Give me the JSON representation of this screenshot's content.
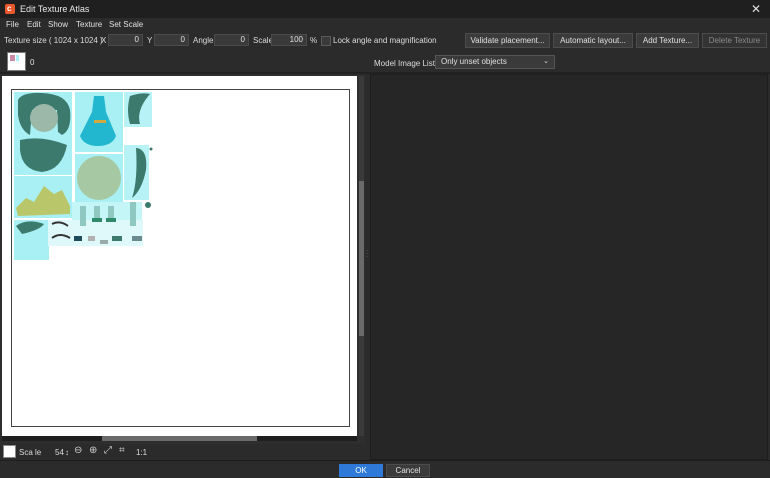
{
  "window": {
    "title": "Edit Texture Atlas",
    "app_icon": "clip-studio-icon",
    "close_icon": "close-icon"
  },
  "menu": [
    "File",
    "Edit",
    "Show",
    "Texture",
    "Set Scale"
  ],
  "toolbar": {
    "texture_size": "Texture size ( 1024 x 1024 )",
    "x_label": "X",
    "x_value": "0",
    "y_label": "Y",
    "y_value": "0",
    "angle_label": "Angle",
    "angle_value": "0",
    "scale_label": "Scale",
    "scale_value": "100",
    "scale_unit": "%",
    "lock_label": "Lock angle and magnification",
    "validate_btn": "Validate placement...",
    "auto_layout_btn": "Automatic layout...",
    "add_texture_btn": "Add Texture...",
    "delete_texture_btn": "Delete Texture"
  },
  "tabs": {
    "texture_index": "0"
  },
  "model_list": {
    "label": "Model Image List",
    "selected": "Only unset objects"
  },
  "bottom": {
    "scale_label": "Sca le",
    "scale_value": "54",
    "fit_label": "1:1"
  },
  "footer": {
    "ok": "OK",
    "cancel": "Cancel"
  },
  "colors": {
    "accent": "#2f7ad8",
    "texture_cyan": "#a8f0f4",
    "texture_teal": "#3d7a6e"
  }
}
